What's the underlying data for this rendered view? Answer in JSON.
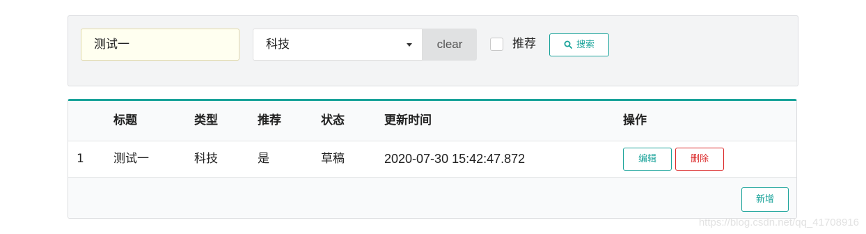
{
  "filter": {
    "title_value": "测试一",
    "type_selected": "科技",
    "clear_label": "clear",
    "recommend_label": "推荐",
    "recommend_checked": false,
    "search_label": "搜索"
  },
  "table": {
    "headers": {
      "index": "",
      "title": "标题",
      "type": "类型",
      "recommend": "推荐",
      "status": "状态",
      "updated": "更新时间",
      "actions": "操作"
    },
    "rows": [
      {
        "index": "1",
        "title": "测试一",
        "type": "科技",
        "recommend": "是",
        "status": "草稿",
        "updated": "2020-07-30 15:42:47.872",
        "edit_label": "编辑",
        "delete_label": "删除"
      }
    ],
    "add_label": "新增"
  },
  "watermark": "https://blog.csdn.net/qq_41708916",
  "colors": {
    "accent": "#1aa39a",
    "danger": "#db2828"
  }
}
